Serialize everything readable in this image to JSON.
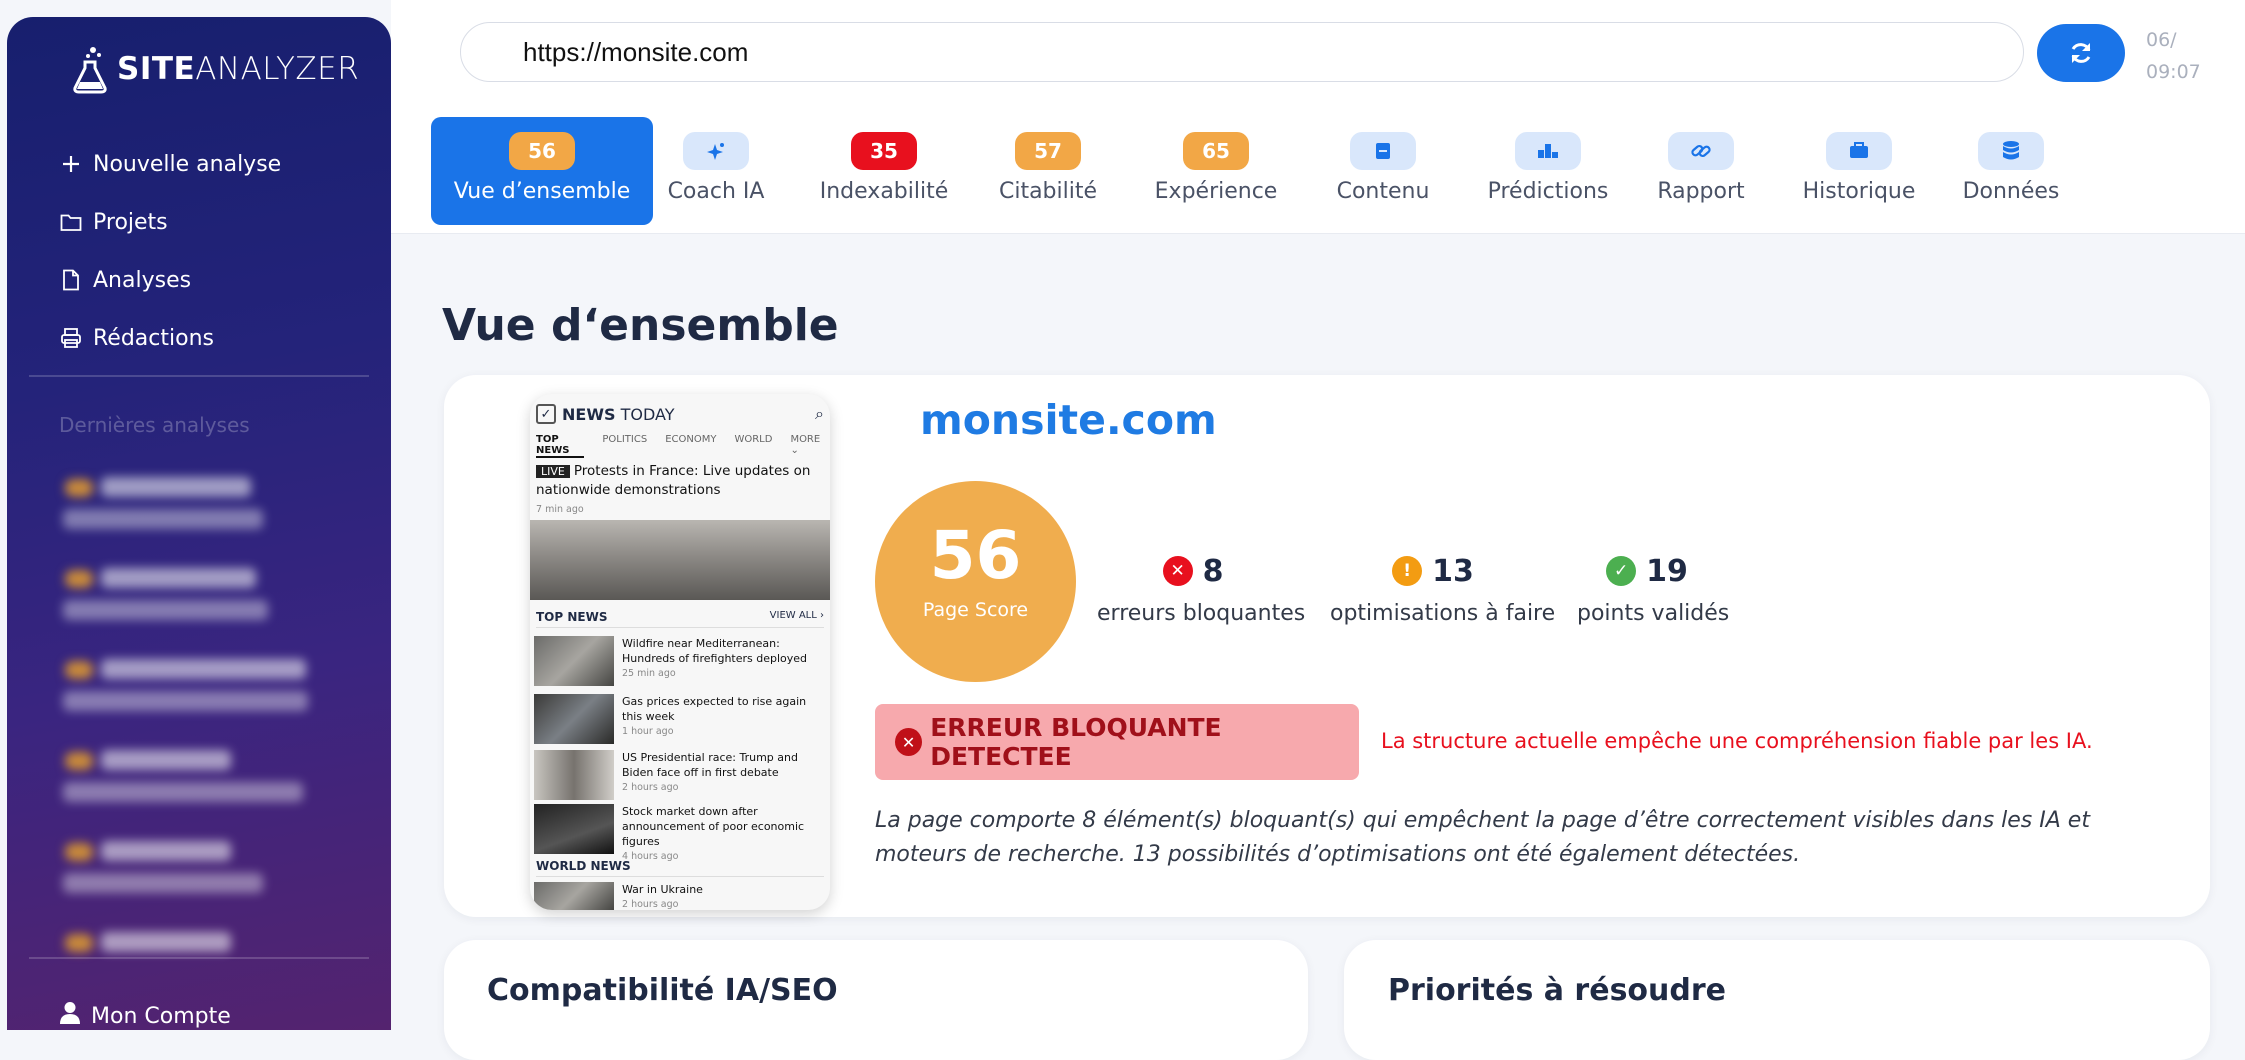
{
  "sidebar": {
    "logo_bold": "SITE",
    "logo_light": "ANALYZER",
    "nav": [
      {
        "label": "Nouvelle analyse",
        "icon": "plus-icon"
      },
      {
        "label": "Projets",
        "icon": "folder-icon"
      },
      {
        "label": "Analyses",
        "icon": "document-icon"
      },
      {
        "label": "Rédactions",
        "icon": "printer-icon"
      }
    ],
    "recent_title": "Dernières analyses",
    "account_label": "Mon Compte"
  },
  "topbar": {
    "url": "https://monsite.com",
    "date_line1": "06/",
    "date_line2": "09:07",
    "refresh_icon": "refresh-icon"
  },
  "tabs": [
    {
      "label": "Vue d’ensemble",
      "badge": "56",
      "kind": "score",
      "active": true
    },
    {
      "label": "Coach IA",
      "badge": "",
      "kind": "icon",
      "icon": "sparkle-icon"
    },
    {
      "label": "Indexabilité",
      "badge": "35",
      "kind": "score-red"
    },
    {
      "label": "Citabilité",
      "badge": "57",
      "kind": "score"
    },
    {
      "label": "Expérience",
      "badge": "65",
      "kind": "score"
    },
    {
      "label": "Contenu",
      "badge": "",
      "kind": "icon",
      "icon": "content-icon"
    },
    {
      "label": "Prédictions",
      "badge": "",
      "kind": "icon",
      "icon": "podium-icon"
    },
    {
      "label": "Rapport",
      "badge": "",
      "kind": "icon",
      "icon": "link-icon"
    },
    {
      "label": "Historique",
      "badge": "",
      "kind": "icon",
      "icon": "briefcase-icon"
    },
    {
      "label": "Données",
      "badge": "",
      "kind": "icon",
      "icon": "database-icon"
    }
  ],
  "colors": {
    "accent": "#1a74e8",
    "score": "#f0ad4e",
    "error": "#e8101e",
    "warning": "#f39c12",
    "success": "#4caf50"
  },
  "main": {
    "title": "Vue d‘ensemble",
    "site": "monsite.com",
    "score": "56",
    "score_label": "Page Score",
    "stats": [
      {
        "count": "8",
        "label": "erreurs bloquantes",
        "icon": "error-icon"
      },
      {
        "count": "13",
        "label": "optimisations à faire",
        "icon": "warning-icon"
      },
      {
        "count": "19",
        "label": "points validés",
        "icon": "check-icon"
      }
    ],
    "alert_title": "ERREUR BLOQUANTE DETECTEE",
    "alert_message": "La structure actuelle empêche une compréhension fiable par les IA.",
    "summary": "La page comporte 8 élément(s) bloquant(s) qui empêchent la page d’être correctement visibles dans les IA et moteurs de recherche. 13 possibilités d’optimisations ont été également détectées.",
    "card1_title": "Compatibilité IA/SEO",
    "card2_title": "Priorités à résoudre"
  },
  "preview": {
    "brand_bold": "NEWS",
    "brand_light": "TODAY",
    "menu": [
      "TOP NEWS",
      "POLITICS",
      "ECONOMY",
      "WORLD",
      "MORE ⌄"
    ],
    "live_tag": "LIVE",
    "live_headline": "Protests in France: Live updates on nationwide demonstrations",
    "live_time": "7 min ago",
    "top_news": "TOP NEWS",
    "view_all": "VIEW ALL ›",
    "items": [
      {
        "title": "Wildfire near Mediterranean: Hundreds of firefighters deployed",
        "time": "25 min ago"
      },
      {
        "title": "Gas prices expected to rise again this week",
        "time": "1 hour ago"
      },
      {
        "title": "US Presidential race: Trump and Biden face off in first debate",
        "time": "2 hours ago"
      },
      {
        "title": "Stock market down after announcement of poor economic figures",
        "time": "4 hours ago"
      }
    ],
    "world_news": "WORLD NEWS",
    "world_item": {
      "title": "War in Ukraine",
      "time": "2 hours ago"
    }
  }
}
